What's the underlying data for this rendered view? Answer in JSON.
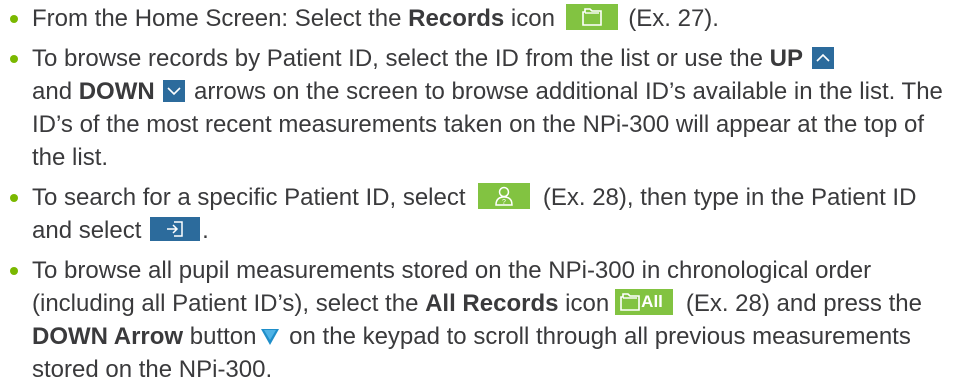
{
  "bullets": [
    {
      "a": "From the Home Screen: Select the ",
      "b": "Records",
      "c": " icon",
      "d": " (Ex. 27)."
    },
    {
      "a": "To browse records by Patient ID, select the ID from the list or use the ",
      "up": "UP",
      "b": "and ",
      "down": "DOWN",
      "c": " arrows on the screen to browse additional ID’s available in the list. The ID’s of the most recent measurements taken on the NPi-300 will appear at the top of the list."
    },
    {
      "a": "To search for a specific Patient ID, select ",
      "b": " (Ex. 28), then type in the Patient ID and select ",
      "c": "."
    },
    {
      "a": "To browse all pupil measurements stored on the NPi-300 in chronological order (including all Patient ID’s), select the ",
      "b": "All Records",
      "c": " icon",
      "d": " (Ex. 28) and press the ",
      "e": "DOWN Arrow",
      "f": " button",
      "g": " on the keypad to scroll through all previous measurements stored on the NPi-300."
    }
  ],
  "icons": {
    "all_label": "All",
    "names": [
      "records-folder-icon",
      "up-arrow-icon",
      "down-arrow-icon",
      "patient-search-icon",
      "enter-icon",
      "all-records-icon",
      "down-triangle-icon"
    ]
  },
  "colors": {
    "bullet": "#7ab800",
    "icon_green": "#82c341",
    "icon_blue": "#2c6b9c",
    "text": "#3a3a3c"
  }
}
